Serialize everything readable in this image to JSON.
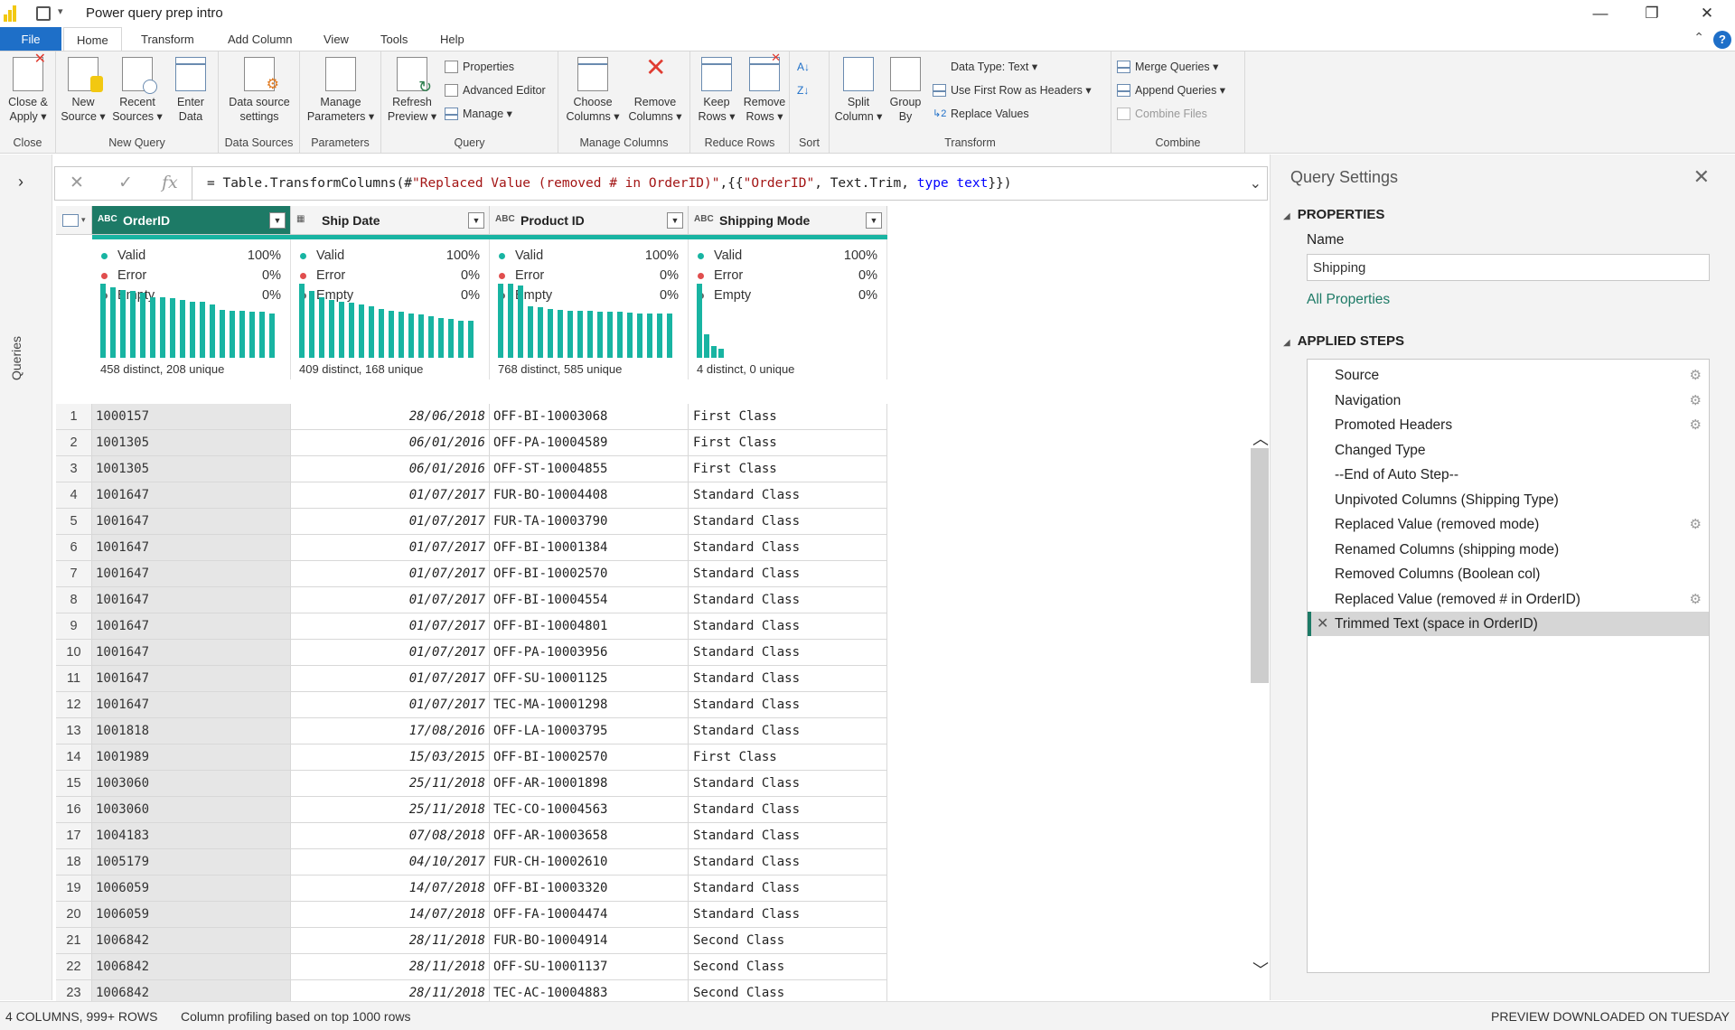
{
  "app": {
    "title": "Power query prep intro",
    "qa_caret": "▾",
    "window_buttons": {
      "minimize": "—",
      "restore": "❐",
      "close": "✕"
    },
    "help": "?",
    "collapse": "⌃"
  },
  "tabs": [
    "File",
    "Home",
    "Transform",
    "Add Column",
    "View",
    "Tools",
    "Help"
  ],
  "ribbon": {
    "groups": {
      "close": "Close",
      "new_query": "New Query",
      "data_sources": "Data Sources",
      "parameters": "Parameters",
      "query": "Query",
      "manage_columns": "Manage Columns",
      "reduce_rows": "Reduce Rows",
      "sort": "Sort",
      "transform": "Transform",
      "combine": "Combine"
    },
    "buttons": {
      "close_apply": [
        "Close &",
        "Apply ▾"
      ],
      "new_source": [
        "New",
        "Source ▾"
      ],
      "recent_sources": [
        "Recent",
        "Sources ▾"
      ],
      "enter_data": [
        "Enter",
        "Data"
      ],
      "data_source_settings": [
        "Data source",
        "settings"
      ],
      "manage_parameters": [
        "Manage",
        "Parameters ▾"
      ],
      "refresh_preview": [
        "Refresh",
        "Preview ▾"
      ],
      "properties": "Properties",
      "advanced_editor": "Advanced Editor",
      "manage": "Manage ▾",
      "choose_columns": [
        "Choose",
        "Columns ▾"
      ],
      "remove_columns": [
        "Remove",
        "Columns ▾"
      ],
      "keep_rows": [
        "Keep",
        "Rows ▾"
      ],
      "remove_rows": [
        "Remove",
        "Rows ▾"
      ],
      "split_column": [
        "Split",
        "Column ▾"
      ],
      "group_by": [
        "Group",
        "By"
      ],
      "data_type": "Data Type: Text ▾",
      "use_first_row": "Use First Row as Headers ▾",
      "replace_values": "Replace Values",
      "merge_queries": "Merge Queries ▾",
      "append_queries": "Append Queries ▾",
      "combine_files": "Combine Files"
    }
  },
  "left_pane": {
    "expand": "›",
    "label": "Queries"
  },
  "formula_bar": {
    "cancel": "✕",
    "commit": "✓",
    "fx": "fx",
    "expand": "⌄",
    "parts": {
      "p1": "= Table.TransformColumns(#",
      "p2": "\"Replaced Value (removed # in OrderID)\"",
      "p3": ",{{",
      "p4": "\"OrderID\"",
      "p5": ", Text.Trim, ",
      "p6": "type text",
      "p7": "}})"
    }
  },
  "grid": {
    "columns": [
      {
        "name": "OrderID",
        "type_icon": "ABC",
        "valid": "100%",
        "error": "0%",
        "empty": "0%",
        "distinct": "458 distinct, 208 unique",
        "bars": [
          1.0,
          0.95,
          0.92,
          0.9,
          0.88,
          0.82,
          0.82,
          0.8,
          0.78,
          0.76,
          0.75,
          0.72,
          0.65,
          0.63,
          0.63,
          0.62,
          0.62,
          0.6
        ]
      },
      {
        "name": "Ship Date",
        "type_icon": "▦",
        "valid": "100%",
        "error": "0%",
        "empty": "0%",
        "distinct": "409 distinct, 168 unique",
        "bars": [
          1.0,
          0.9,
          0.82,
          0.78,
          0.76,
          0.74,
          0.72,
          0.7,
          0.66,
          0.64,
          0.62,
          0.6,
          0.58,
          0.56,
          0.54,
          0.52,
          0.5,
          0.5
        ]
      },
      {
        "name": "Product ID",
        "type_icon": "ABC",
        "valid": "100%",
        "error": "0%",
        "empty": "0%",
        "distinct": "768 distinct, 585 unique",
        "bars": [
          1.0,
          1.0,
          0.98,
          0.7,
          0.68,
          0.66,
          0.65,
          0.64,
          0.63,
          0.63,
          0.62,
          0.62,
          0.62,
          0.61,
          0.6,
          0.6,
          0.6,
          0.6
        ]
      },
      {
        "name": "Shipping Mode",
        "type_icon": "ABC",
        "valid": "100%",
        "error": "0%",
        "empty": "0%",
        "distinct": "4 distinct, 0 unique",
        "bars": [
          1.0,
          0.32,
          0.16,
          0.12
        ]
      }
    ],
    "profile_labels": {
      "valid": "Valid",
      "error": "Error",
      "empty": "Empty"
    },
    "rows": [
      [
        "1",
        "1000157",
        "28/06/2018",
        "OFF-BI-10003068",
        "First Class"
      ],
      [
        "2",
        "1001305",
        "06/01/2016",
        "OFF-PA-10004589",
        "First Class"
      ],
      [
        "3",
        "1001305",
        "06/01/2016",
        "OFF-ST-10004855",
        "First Class"
      ],
      [
        "4",
        "1001647",
        "01/07/2017",
        "FUR-BO-10004408",
        "Standard Class"
      ],
      [
        "5",
        "1001647",
        "01/07/2017",
        "FUR-TA-10003790",
        "Standard Class"
      ],
      [
        "6",
        "1001647",
        "01/07/2017",
        "OFF-BI-10001384",
        "Standard Class"
      ],
      [
        "7",
        "1001647",
        "01/07/2017",
        "OFF-BI-10002570",
        "Standard Class"
      ],
      [
        "8",
        "1001647",
        "01/07/2017",
        "OFF-BI-10004554",
        "Standard Class"
      ],
      [
        "9",
        "1001647",
        "01/07/2017",
        "OFF-BI-10004801",
        "Standard Class"
      ],
      [
        "10",
        "1001647",
        "01/07/2017",
        "OFF-PA-10003956",
        "Standard Class"
      ],
      [
        "11",
        "1001647",
        "01/07/2017",
        "OFF-SU-10001125",
        "Standard Class"
      ],
      [
        "12",
        "1001647",
        "01/07/2017",
        "TEC-MA-10001298",
        "Standard Class"
      ],
      [
        "13",
        "1001818",
        "17/08/2016",
        "OFF-LA-10003795",
        "Standard Class"
      ],
      [
        "14",
        "1001989",
        "15/03/2015",
        "OFF-BI-10002570",
        "First Class"
      ],
      [
        "15",
        "1003060",
        "25/11/2018",
        "OFF-AR-10001898",
        "Standard Class"
      ],
      [
        "16",
        "1003060",
        "25/11/2018",
        "TEC-CO-10004563",
        "Standard Class"
      ],
      [
        "17",
        "1004183",
        "07/08/2018",
        "OFF-AR-10003658",
        "Standard Class"
      ],
      [
        "18",
        "1005179",
        "04/10/2017",
        "FUR-CH-10002610",
        "Standard Class"
      ],
      [
        "19",
        "1006059",
        "14/07/2018",
        "OFF-BI-10003320",
        "Standard Class"
      ],
      [
        "20",
        "1006059",
        "14/07/2018",
        "OFF-FA-10004474",
        "Standard Class"
      ],
      [
        "21",
        "1006842",
        "28/11/2018",
        "FUR-BO-10004914",
        "Second Class"
      ],
      [
        "22",
        "1006842",
        "28/11/2018",
        "OFF-SU-10001137",
        "Second Class"
      ],
      [
        "23",
        "1006842",
        "28/11/2018",
        "TEC-AC-10004883",
        "Second Class"
      ]
    ]
  },
  "settings": {
    "header": "Query Settings",
    "close": "✕",
    "properties_label": "PROPERTIES",
    "name_label": "Name",
    "name_value": "Shipping",
    "all_properties": "All Properties",
    "applied_steps_label": "APPLIED STEPS",
    "steps": [
      {
        "label": "Source",
        "gear": true
      },
      {
        "label": "Navigation",
        "gear": true
      },
      {
        "label": "Promoted Headers",
        "gear": true
      },
      {
        "label": "Changed Type",
        "gear": false
      },
      {
        "label": "--End of Auto Step--",
        "gear": false
      },
      {
        "label": "Unpivoted Columns (Shipping Type)",
        "gear": false
      },
      {
        "label": "Replaced Value (removed mode)",
        "gear": true
      },
      {
        "label": "Renamed Columns (shipping mode)",
        "gear": false
      },
      {
        "label": "Removed Columns (Boolean col)",
        "gear": false
      },
      {
        "label": "Replaced Value (removed # in OrderID)",
        "gear": true
      },
      {
        "label": "Trimmed Text (space in OrderID)",
        "gear": false,
        "selected": true
      }
    ]
  },
  "status": {
    "columns_rows": "4 COLUMNS, 999+ ROWS",
    "profiling": "Column profiling based on top 1000 rows",
    "preview": "PREVIEW DOWNLOADED ON TUESDAY"
  },
  "colors": {
    "accent": "#1d7a66",
    "teal": "#18b4a2",
    "file_tab": "#1e6fc8"
  }
}
